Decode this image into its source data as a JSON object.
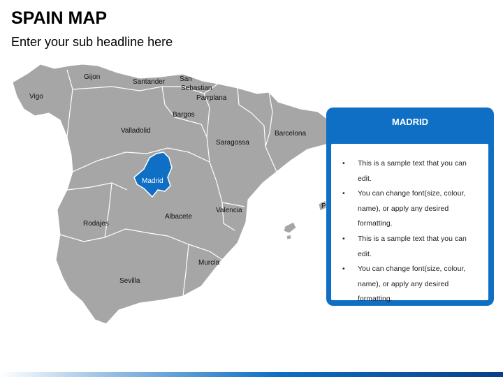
{
  "header": {
    "title": "SPAIN MAP",
    "subtitle": "Enter your sub headline here"
  },
  "map": {
    "highlight_color": "#0e6fc4",
    "region_color": "#a6a6a6",
    "labels": {
      "gijon": "Gijon",
      "santander": "Santander",
      "san_sebastian_1": "San",
      "san_sebastian_2": "Sebastian",
      "vigo": "Vigo",
      "parrplana": "Parrplana",
      "bargos": "Bargos",
      "valladolid": "Valladolid",
      "saragossa": "Saragossa",
      "barcelona": "Barcelona",
      "madrid": "Madrid",
      "valencia": "Valencia",
      "albacete": "Albacete",
      "rodajes": "Rodajes",
      "murcia": "Murcia",
      "sevilla": "Sevilla",
      "p": "P"
    }
  },
  "callout": {
    "title": "MADRID",
    "bullets": [
      "This is a sample text that you can edit.",
      "You can change font(size, colour,",
      "name), or apply any desired",
      "formatting.",
      "This is a sample text that you can edit.",
      "You can change font(size, colour,",
      "name), or apply any desired",
      "formatting."
    ]
  }
}
